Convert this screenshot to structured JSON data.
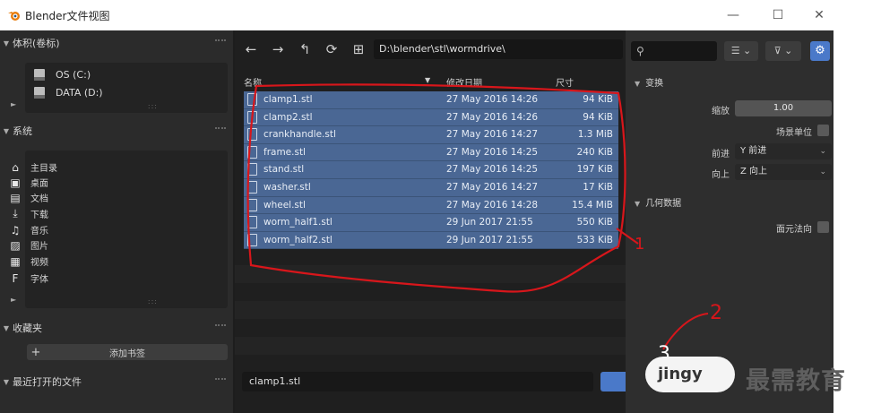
{
  "window": {
    "title": "Blender文件视图",
    "minimize": "—",
    "maximize": "☐",
    "close": "✕"
  },
  "left": {
    "volumes_header": "体积(卷标)",
    "drives": [
      {
        "label": "OS (C:)"
      },
      {
        "label": "DATA (D:)"
      }
    ],
    "system_header": "系统",
    "system_items": [
      {
        "label": "主目录",
        "icon": "home-icon",
        "glyph": "⌂"
      },
      {
        "label": "桌面",
        "icon": "desktop-icon",
        "glyph": "▣"
      },
      {
        "label": "文档",
        "icon": "documents-icon",
        "glyph": "▤"
      },
      {
        "label": "下载",
        "icon": "download-icon",
        "glyph": "⤓"
      },
      {
        "label": "音乐",
        "icon": "music-icon",
        "glyph": "♫"
      },
      {
        "label": "图片",
        "icon": "pictures-icon",
        "glyph": "▨"
      },
      {
        "label": "视频",
        "icon": "video-icon",
        "glyph": "▦"
      },
      {
        "label": "字体",
        "icon": "font-icon",
        "glyph": "F"
      }
    ],
    "bookmarks_header": "收藏夹",
    "add_bookmark": "添加书签",
    "recent_header": "最近打开的文件"
  },
  "toolbar": {
    "back": "←",
    "forward": "→",
    "parent": "↰",
    "refresh": "⟳",
    "new_folder": "⊞",
    "path": "D:\\blender\\stl\\wormdrive\\"
  },
  "columns": {
    "name": "名称",
    "date": "修改日期",
    "size": "尺寸"
  },
  "files": [
    {
      "name": "clamp1.stl",
      "date": "27 May 2016 14:26",
      "size": "94 KiB"
    },
    {
      "name": "clamp2.stl",
      "date": "27 May 2016 14:26",
      "size": "94 KiB"
    },
    {
      "name": "crankhandle.stl",
      "date": "27 May 2016 14:27",
      "size": "1.3 MiB"
    },
    {
      "name": "frame.stl",
      "date": "27 May 2016 14:25",
      "size": "240 KiB"
    },
    {
      "name": "stand.stl",
      "date": "27 May 2016 14:25",
      "size": "197 KiB"
    },
    {
      "name": "washer.stl",
      "date": "27 May 2016 14:27",
      "size": "17 KiB"
    },
    {
      "name": "wheel.stl",
      "date": "27 May 2016 14:28",
      "size": "15.4 MiB"
    },
    {
      "name": "worm_half1.stl",
      "date": "29 Jun 2017 21:55",
      "size": "550 KiB"
    },
    {
      "name": "worm_half2.stl",
      "date": "29 Jun 2017 21:55",
      "size": "533 KiB"
    }
  ],
  "bottom": {
    "filename": "clamp1.stl"
  },
  "right": {
    "search_icon": "⚲",
    "transform_header": "变换",
    "scale_label": "缩放",
    "scale_value": "1.00",
    "scene_unit_label": "场景单位",
    "forward_label": "前进",
    "forward_value": "Y 前进",
    "up_label": "向上",
    "up_value": "Z 向上",
    "geometry_header": "几何数据",
    "face_normals_label": "面元法向"
  },
  "overlay": {
    "annotation_1": "1",
    "annotation_2": "2",
    "annotation_3": "3",
    "logo_text": "jingy",
    "watermark": "最需教育"
  },
  "colors": {
    "selection": "#4a6794",
    "accent": "#4a79c9",
    "annotation": "#d8161b"
  }
}
